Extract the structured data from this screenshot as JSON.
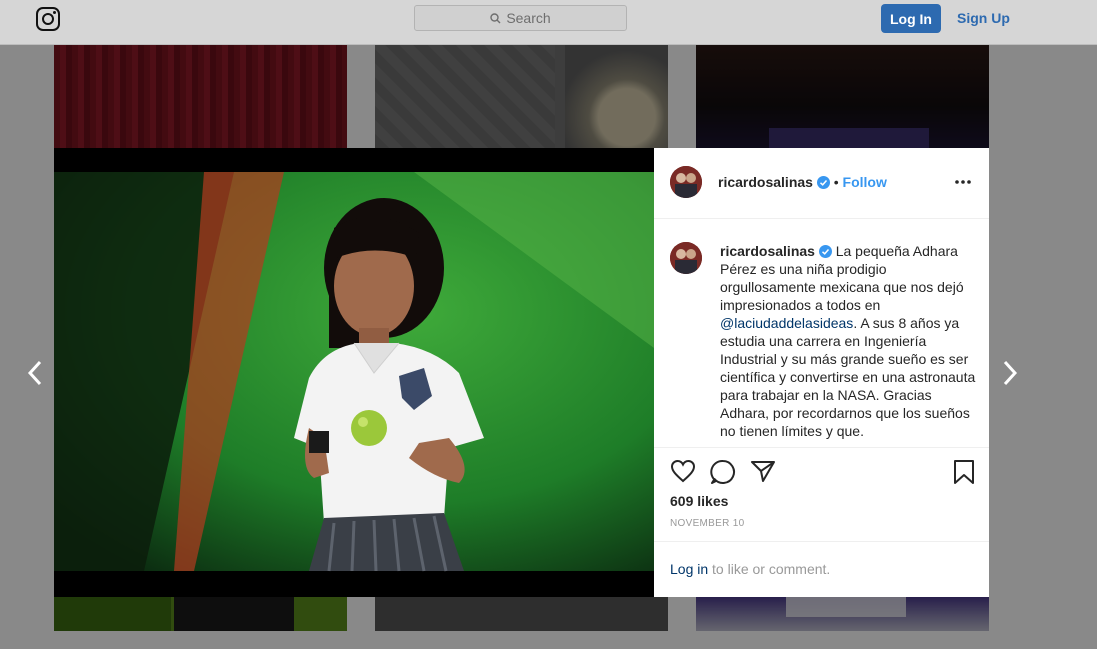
{
  "header": {
    "search_placeholder": "Search",
    "login_label": "Log In",
    "signup_label": "Sign Up"
  },
  "post": {
    "username": "ricardosalinas",
    "follow_label": "Follow",
    "separator": "•",
    "caption_user": "ricardosalinas",
    "caption_part1": "La pequeña Adhara Pérez es una niña prodigio orgullosamente mexicana que nos dejó impresionados a todos en ",
    "mention": "@laciudaddelasideas",
    "caption_part2": ". A sus 8 años ya estudia una carrera en Ingeniería Industrial y su más grande sueño es ser científica y convertirse en una astronauta para trabajar en la NASA. Gracias Adhara, por recordarnos que los sueños no tienen límites y que.",
    "likes": "609 likes",
    "date": "NOVEMBER 10",
    "login_link": "Log in",
    "login_suffix": " to like or comment."
  },
  "icons": {
    "logo": "instagram-icon",
    "verified": "verified-badge-icon",
    "more": "more-options-icon",
    "like": "heart-icon",
    "comment": "comment-icon",
    "share": "share-icon",
    "save": "bookmark-icon",
    "prev": "chevron-left-icon",
    "next": "chevron-right-icon"
  },
  "colors": {
    "accent": "#3897f0",
    "button": "#2d6ab0"
  }
}
